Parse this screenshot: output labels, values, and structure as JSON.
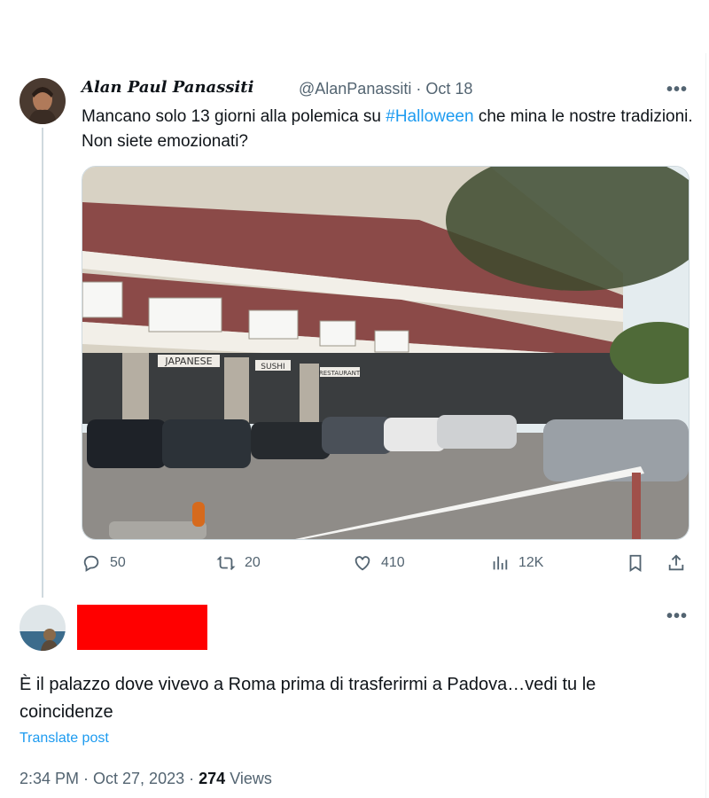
{
  "tweet": {
    "author_name": "Alan Paul Panassiti",
    "handle": "@AlanPanassiti",
    "separator": "·",
    "date": "Oct 18",
    "more_label": "•••",
    "text_before": "Mancano solo 13 giorni alla polemica su ",
    "hashtag": "#Halloween",
    "text_after": " che mina le nostre tradizioni. Non siete emozionati?",
    "media": {
      "storefront_signs": [
        "JAPANESE",
        "SUSHI",
        "RESTAURANT"
      ],
      "colors": {
        "sky": "#e4ecef",
        "facade": "#d8d2c4",
        "railing": "#8b4a48",
        "asphalt": "#8f8c88"
      }
    },
    "actions": {
      "replies": "50",
      "reposts": "20",
      "likes": "410",
      "views": "12K"
    }
  },
  "reply": {
    "more_label": "•••",
    "text": "È il palazzo dove vivevo a Roma prima di trasferirmi a Padova…vedi tu le coincidenze",
    "translate_label": "Translate post",
    "timestamp": "2:34 PM · Oct 27, 2023",
    "separator": "·",
    "views_count": "274",
    "views_label": "Views"
  },
  "colors": {
    "accent": "#1d9bf0",
    "secondary_text": "#536471",
    "primary_text": "#0f1419",
    "redaction": "#ff0000"
  }
}
